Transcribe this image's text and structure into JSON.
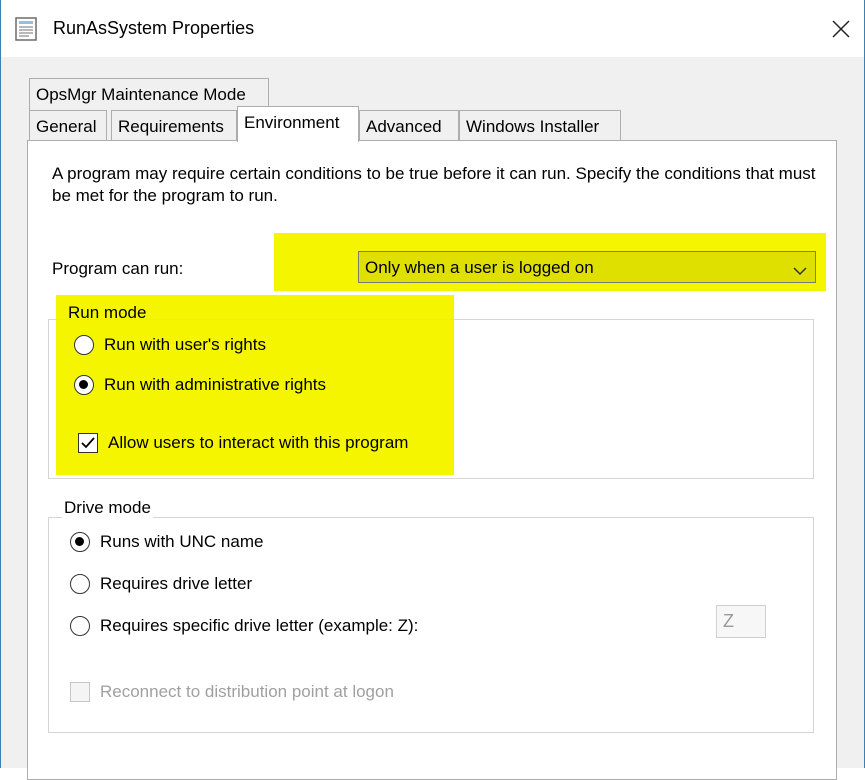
{
  "window": {
    "title": "RunAsSystem Properties"
  },
  "tabs": {
    "row1": [
      "OpsMgr Maintenance Mode"
    ],
    "row2": [
      "General",
      "Requirements",
      "Environment",
      "Advanced",
      "Windows Installer"
    ],
    "active": "Environment"
  },
  "environment": {
    "description": "A program may require certain conditions to be true before it can run. Specify the conditions that must be met for the program to run.",
    "program_can_run_label": "Program can run:",
    "program_can_run_value": "Only when a user is logged on",
    "run_mode": {
      "title": "Run mode",
      "option_user": "Run with user's rights",
      "option_admin": "Run with administrative rights",
      "selected": "admin",
      "allow_interact_label": "Allow users to interact with this program",
      "allow_interact_checked": true
    },
    "drive_mode": {
      "title": "Drive mode",
      "option_unc": "Runs with UNC name",
      "option_letter": "Requires drive letter",
      "option_specific": "Requires specific drive letter (example: Z):",
      "selected": "unc",
      "drive_letter_value": "Z",
      "reconnect_label": "Reconnect to distribution point at logon",
      "reconnect_checked": false
    }
  },
  "colors": {
    "highlight": "#f5f500",
    "border": "#adadad",
    "window_border": "#3c7fb1"
  }
}
